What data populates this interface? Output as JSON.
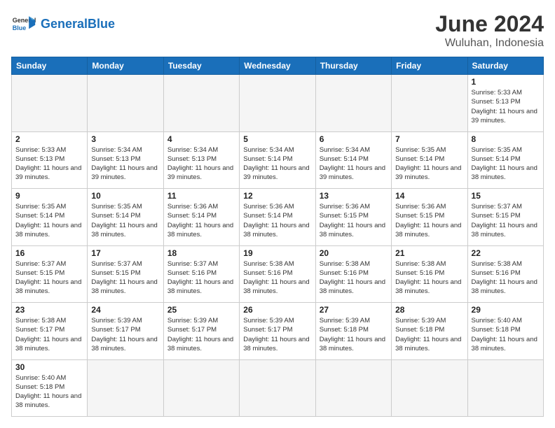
{
  "header": {
    "logo_general": "General",
    "logo_blue": "Blue",
    "month_title": "June 2024",
    "location": "Wuluhan, Indonesia"
  },
  "days_of_week": [
    "Sunday",
    "Monday",
    "Tuesday",
    "Wednesday",
    "Thursday",
    "Friday",
    "Saturday"
  ],
  "weeks": [
    [
      {
        "day": "",
        "sunrise": "",
        "sunset": "",
        "daylight": ""
      },
      {
        "day": "",
        "sunrise": "",
        "sunset": "",
        "daylight": ""
      },
      {
        "day": "",
        "sunrise": "",
        "sunset": "",
        "daylight": ""
      },
      {
        "day": "",
        "sunrise": "",
        "sunset": "",
        "daylight": ""
      },
      {
        "day": "",
        "sunrise": "",
        "sunset": "",
        "daylight": ""
      },
      {
        "day": "",
        "sunrise": "",
        "sunset": "",
        "daylight": ""
      },
      {
        "day": "1",
        "sunrise": "Sunrise: 5:33 AM",
        "sunset": "Sunset: 5:13 PM",
        "daylight": "Daylight: 11 hours and 39 minutes."
      }
    ],
    [
      {
        "day": "2",
        "sunrise": "Sunrise: 5:33 AM",
        "sunset": "Sunset: 5:13 PM",
        "daylight": "Daylight: 11 hours and 39 minutes."
      },
      {
        "day": "3",
        "sunrise": "Sunrise: 5:34 AM",
        "sunset": "Sunset: 5:13 PM",
        "daylight": "Daylight: 11 hours and 39 minutes."
      },
      {
        "day": "4",
        "sunrise": "Sunrise: 5:34 AM",
        "sunset": "Sunset: 5:13 PM",
        "daylight": "Daylight: 11 hours and 39 minutes."
      },
      {
        "day": "5",
        "sunrise": "Sunrise: 5:34 AM",
        "sunset": "Sunset: 5:14 PM",
        "daylight": "Daylight: 11 hours and 39 minutes."
      },
      {
        "day": "6",
        "sunrise": "Sunrise: 5:34 AM",
        "sunset": "Sunset: 5:14 PM",
        "daylight": "Daylight: 11 hours and 39 minutes."
      },
      {
        "day": "7",
        "sunrise": "Sunrise: 5:35 AM",
        "sunset": "Sunset: 5:14 PM",
        "daylight": "Daylight: 11 hours and 39 minutes."
      },
      {
        "day": "8",
        "sunrise": "Sunrise: 5:35 AM",
        "sunset": "Sunset: 5:14 PM",
        "daylight": "Daylight: 11 hours and 38 minutes."
      }
    ],
    [
      {
        "day": "9",
        "sunrise": "Sunrise: 5:35 AM",
        "sunset": "Sunset: 5:14 PM",
        "daylight": "Daylight: 11 hours and 38 minutes."
      },
      {
        "day": "10",
        "sunrise": "Sunrise: 5:35 AM",
        "sunset": "Sunset: 5:14 PM",
        "daylight": "Daylight: 11 hours and 38 minutes."
      },
      {
        "day": "11",
        "sunrise": "Sunrise: 5:36 AM",
        "sunset": "Sunset: 5:14 PM",
        "daylight": "Daylight: 11 hours and 38 minutes."
      },
      {
        "day": "12",
        "sunrise": "Sunrise: 5:36 AM",
        "sunset": "Sunset: 5:14 PM",
        "daylight": "Daylight: 11 hours and 38 minutes."
      },
      {
        "day": "13",
        "sunrise": "Sunrise: 5:36 AM",
        "sunset": "Sunset: 5:15 PM",
        "daylight": "Daylight: 11 hours and 38 minutes."
      },
      {
        "day": "14",
        "sunrise": "Sunrise: 5:36 AM",
        "sunset": "Sunset: 5:15 PM",
        "daylight": "Daylight: 11 hours and 38 minutes."
      },
      {
        "day": "15",
        "sunrise": "Sunrise: 5:37 AM",
        "sunset": "Sunset: 5:15 PM",
        "daylight": "Daylight: 11 hours and 38 minutes."
      }
    ],
    [
      {
        "day": "16",
        "sunrise": "Sunrise: 5:37 AM",
        "sunset": "Sunset: 5:15 PM",
        "daylight": "Daylight: 11 hours and 38 minutes."
      },
      {
        "day": "17",
        "sunrise": "Sunrise: 5:37 AM",
        "sunset": "Sunset: 5:15 PM",
        "daylight": "Daylight: 11 hours and 38 minutes."
      },
      {
        "day": "18",
        "sunrise": "Sunrise: 5:37 AM",
        "sunset": "Sunset: 5:16 PM",
        "daylight": "Daylight: 11 hours and 38 minutes."
      },
      {
        "day": "19",
        "sunrise": "Sunrise: 5:38 AM",
        "sunset": "Sunset: 5:16 PM",
        "daylight": "Daylight: 11 hours and 38 minutes."
      },
      {
        "day": "20",
        "sunrise": "Sunrise: 5:38 AM",
        "sunset": "Sunset: 5:16 PM",
        "daylight": "Daylight: 11 hours and 38 minutes."
      },
      {
        "day": "21",
        "sunrise": "Sunrise: 5:38 AM",
        "sunset": "Sunset: 5:16 PM",
        "daylight": "Daylight: 11 hours and 38 minutes."
      },
      {
        "day": "22",
        "sunrise": "Sunrise: 5:38 AM",
        "sunset": "Sunset: 5:16 PM",
        "daylight": "Daylight: 11 hours and 38 minutes."
      }
    ],
    [
      {
        "day": "23",
        "sunrise": "Sunrise: 5:38 AM",
        "sunset": "Sunset: 5:17 PM",
        "daylight": "Daylight: 11 hours and 38 minutes."
      },
      {
        "day": "24",
        "sunrise": "Sunrise: 5:39 AM",
        "sunset": "Sunset: 5:17 PM",
        "daylight": "Daylight: 11 hours and 38 minutes."
      },
      {
        "day": "25",
        "sunrise": "Sunrise: 5:39 AM",
        "sunset": "Sunset: 5:17 PM",
        "daylight": "Daylight: 11 hours and 38 minutes."
      },
      {
        "day": "26",
        "sunrise": "Sunrise: 5:39 AM",
        "sunset": "Sunset: 5:17 PM",
        "daylight": "Daylight: 11 hours and 38 minutes."
      },
      {
        "day": "27",
        "sunrise": "Sunrise: 5:39 AM",
        "sunset": "Sunset: 5:18 PM",
        "daylight": "Daylight: 11 hours and 38 minutes."
      },
      {
        "day": "28",
        "sunrise": "Sunrise: 5:39 AM",
        "sunset": "Sunset: 5:18 PM",
        "daylight": "Daylight: 11 hours and 38 minutes."
      },
      {
        "day": "29",
        "sunrise": "Sunrise: 5:40 AM",
        "sunset": "Sunset: 5:18 PM",
        "daylight": "Daylight: 11 hours and 38 minutes."
      }
    ],
    [
      {
        "day": "30",
        "sunrise": "Sunrise: 5:40 AM",
        "sunset": "Sunset: 5:18 PM",
        "daylight": "Daylight: 11 hours and 38 minutes."
      },
      {
        "day": "",
        "sunrise": "",
        "sunset": "",
        "daylight": ""
      },
      {
        "day": "",
        "sunrise": "",
        "sunset": "",
        "daylight": ""
      },
      {
        "day": "",
        "sunrise": "",
        "sunset": "",
        "daylight": ""
      },
      {
        "day": "",
        "sunrise": "",
        "sunset": "",
        "daylight": ""
      },
      {
        "day": "",
        "sunrise": "",
        "sunset": "",
        "daylight": ""
      },
      {
        "day": "",
        "sunrise": "",
        "sunset": "",
        "daylight": ""
      }
    ]
  ]
}
